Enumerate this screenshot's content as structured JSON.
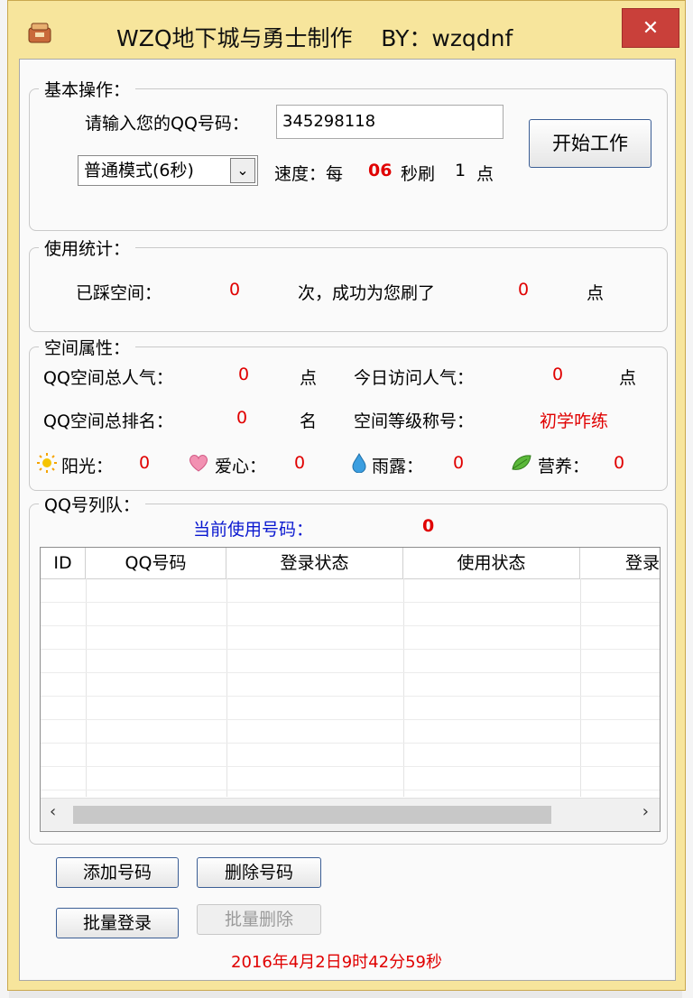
{
  "window": {
    "title": "WZQ地下城与勇士制作    BY：wzqdnf",
    "close_glyph": "✕"
  },
  "basic": {
    "legend": "基本操作：",
    "qq_label": "请输入您的QQ号码：",
    "qq_value": "345298118",
    "mode_value": "普通模式(6秒)",
    "speed_prefix": "速度：每",
    "speed_number": "06",
    "speed_mid": "秒刷",
    "speed_points": "1",
    "speed_unit": "点",
    "start_button": "开始工作"
  },
  "stats": {
    "legend": "使用统计：",
    "visited_label": "已踩空间：",
    "visited_value": "0",
    "mid_text": "次，成功为您刷了",
    "success_value": "0",
    "unit": "点"
  },
  "space": {
    "legend": "空间属性：",
    "total_pop_label": "QQ空间总人气：",
    "total_pop_value": "0",
    "total_pop_unit": "点",
    "today_label": "今日访问人气：",
    "today_value": "0",
    "today_unit": "点",
    "rank_label": "QQ空间总排名：",
    "rank_value": "0",
    "rank_unit": "名",
    "level_label": "空间等级称号：",
    "level_value": "初学咋练",
    "sun_label": "阳光：",
    "sun_value": "0",
    "love_label": "爱心：",
    "love_value": "0",
    "dew_label": "雨露：",
    "dew_value": "0",
    "nutrition_label": "营养：",
    "nutrition_value": "0"
  },
  "queue": {
    "legend": "QQ号列队：",
    "current_label": "当前使用号码：",
    "current_value": "0",
    "columns": [
      "ID",
      "QQ号码",
      "登录状态",
      "使用状态",
      "登录"
    ],
    "rows": []
  },
  "buttons": {
    "add": "添加号码",
    "delete": "删除号码",
    "batch_login": "批量登录",
    "batch_delete": "批量删除"
  },
  "footer": {
    "datetime": "2016年4月2日9时42分59秒"
  },
  "colors": {
    "frame": "#f7e59c",
    "close": "#c9403a",
    "value_red": "#e00000",
    "label_blue": "#0a18d0"
  }
}
